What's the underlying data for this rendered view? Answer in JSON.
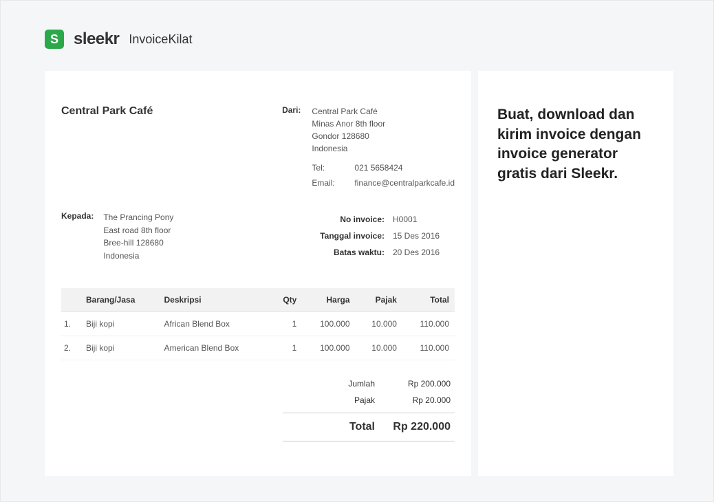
{
  "brand": {
    "logo_letter": "S",
    "name": "sleekr",
    "product_bold": "Invoice",
    "product_light": "Kilat"
  },
  "aside": {
    "title": "Buat, download dan kirim invoice dengan invoice generator gratis dari Sleekr."
  },
  "invoice": {
    "company": "Central Park Café",
    "from_label": "Dari:",
    "from": {
      "name": "Central Park Café",
      "line1": "Minas Anor 8th floor",
      "line2": "Gondor 128680",
      "country": "Indonesia",
      "tel_label": "Tel:",
      "tel": "021 5658424",
      "email_label": "Email:",
      "email": "finance@centralparkcafe.id"
    },
    "to_label": "Kepada:",
    "to": {
      "name": "The Prancing Pony",
      "line1": "East road 8th floor",
      "line2": "Bree-hill 128680",
      "country": "Indonesia"
    },
    "meta": {
      "no_label": "No invoice:",
      "no": "H0001",
      "date_label": "Tanggal invoice:",
      "date": "15 Des 2016",
      "due_label": "Batas waktu:",
      "due": "20 Des 2016"
    },
    "table": {
      "headers": {
        "item": "Barang/Jasa",
        "desc": "Deskripsi",
        "qty": "Qty",
        "price": "Harga",
        "tax": "Pajak",
        "total": "Total"
      },
      "rows": [
        {
          "idx": "1.",
          "item": "Biji kopi",
          "desc": "African Blend Box",
          "qty": "1",
          "price": "100.000",
          "tax": "10.000",
          "total": "110.000"
        },
        {
          "idx": "2.",
          "item": "Biji kopi",
          "desc": "American Blend Box",
          "qty": "1",
          "price": "100.000",
          "tax": "10.000",
          "total": "110.000"
        }
      ]
    },
    "totals": {
      "subtotal_label": "Jumlah",
      "subtotal": "Rp 200.000",
      "tax_label": "Pajak",
      "tax": "Rp 20.000",
      "grand_label": "Total",
      "grand": "Rp 220.000"
    }
  }
}
